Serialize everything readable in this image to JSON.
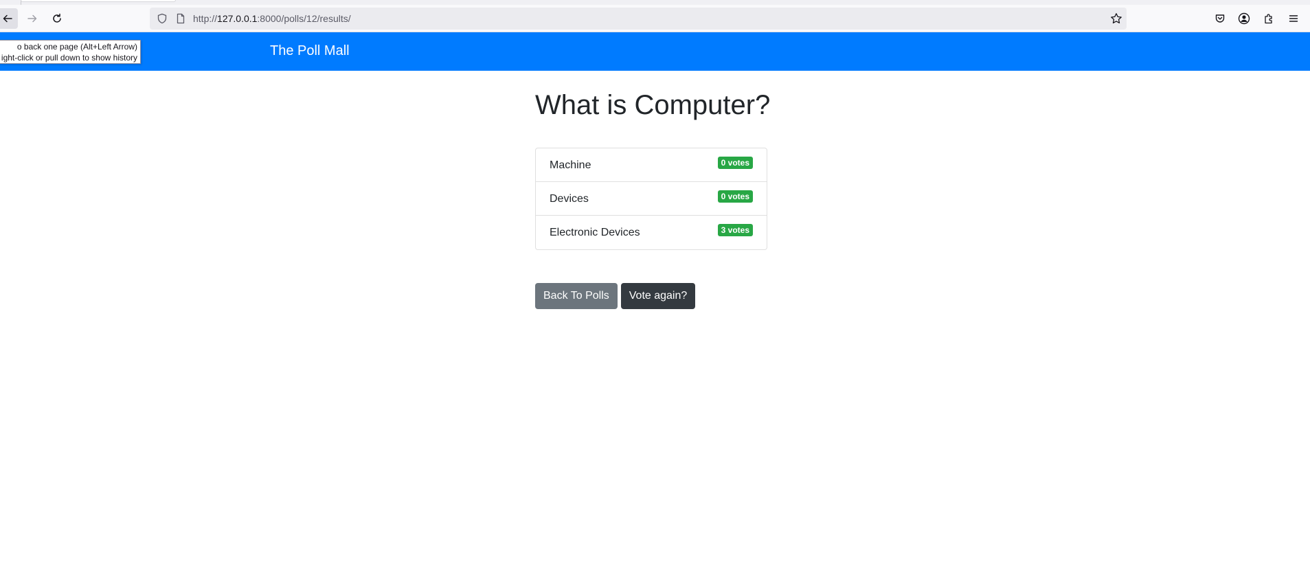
{
  "browser": {
    "url_prefix": "http://",
    "url_host": "127.0.0.1",
    "url_rest": ":8000/polls/12/results/",
    "tooltip_line1": "o back one page (Alt+Left Arrow)",
    "tooltip_line2": "ight-click or pull down to show history"
  },
  "navbar": {
    "brand": "The Poll Mall",
    "color": "#007bff"
  },
  "poll": {
    "question": "What is Computer?",
    "choices": [
      {
        "text": "Machine",
        "votes": "0 votes"
      },
      {
        "text": "Devices",
        "votes": "0 votes"
      },
      {
        "text": "Electronic Devices",
        "votes": "3 votes"
      }
    ],
    "badge_color": "#28a745"
  },
  "actions": {
    "back_label": "Back To Polls",
    "vote_again_label": "Vote again?"
  },
  "icons": [
    "back-arrow-icon",
    "forward-arrow-icon",
    "reload-icon",
    "shield-icon",
    "page-icon",
    "star-icon",
    "pocket-icon",
    "account-icon",
    "extensions-icon",
    "menu-icon"
  ]
}
